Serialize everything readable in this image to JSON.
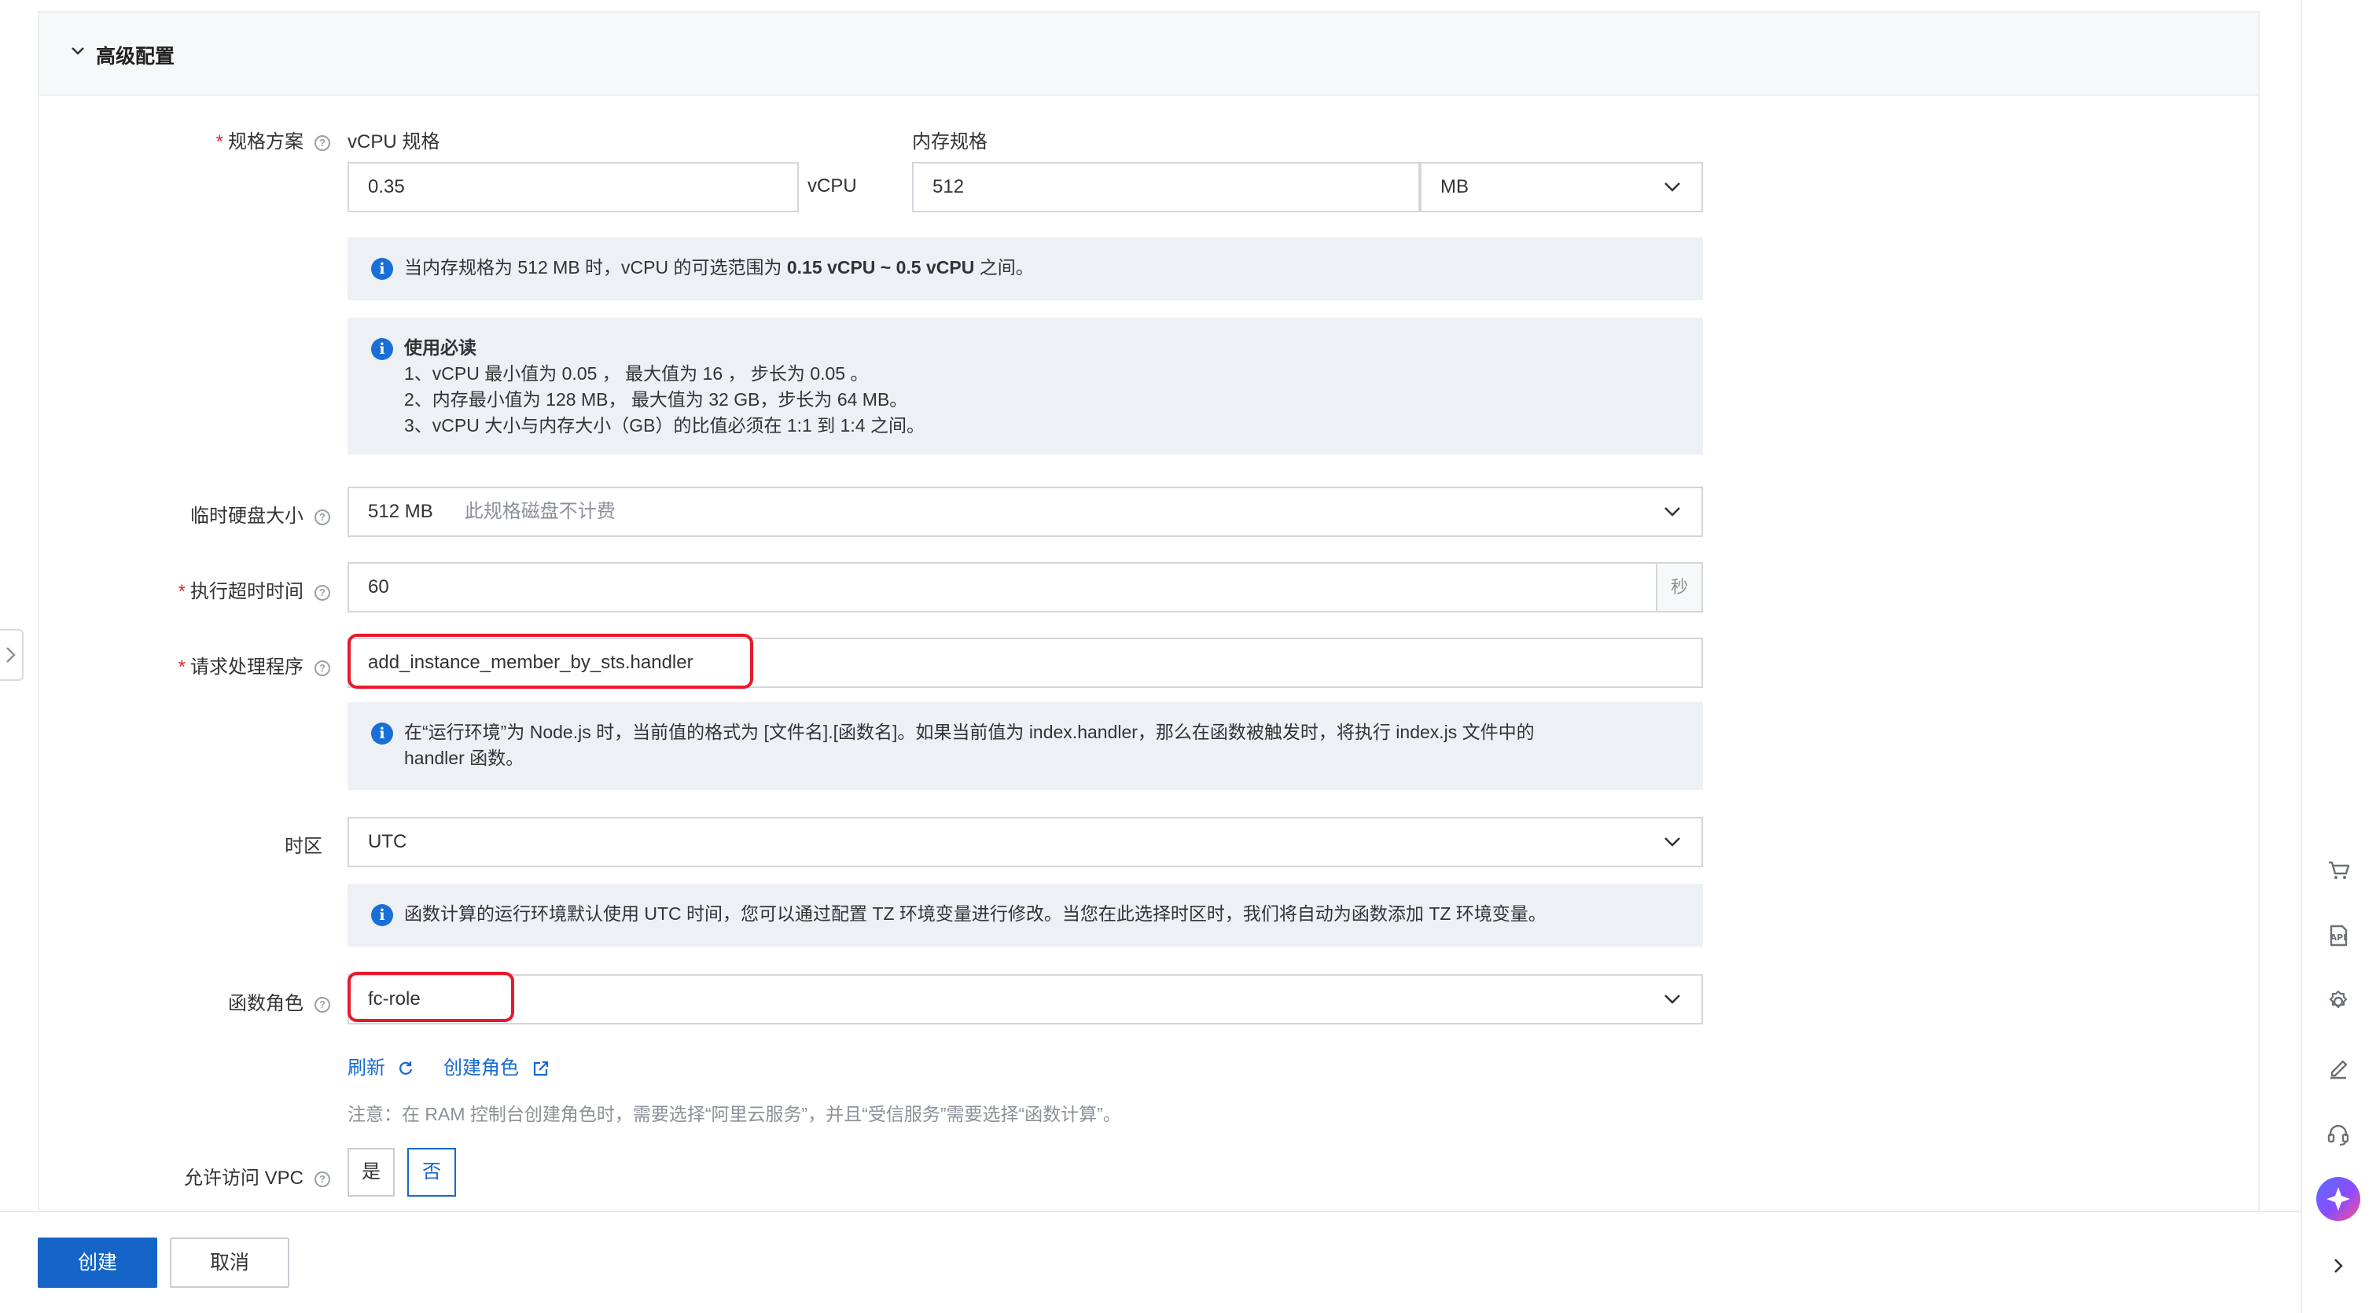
{
  "panel": {
    "title": "高级配置"
  },
  "spec": {
    "label": "规格方案",
    "vcpu_label": "vCPU 规格",
    "vcpu_value": "0.35",
    "vcpu_unit": "vCPU",
    "mem_label": "内存规格",
    "mem_value": "512",
    "mem_unit": "MB",
    "range_tip_prefix": "当内存规格为 512 MB 时，vCPU 的可选范围为 ",
    "range_tip_bold": "0.15 vCPU ~ 0.5 vCPU",
    "range_tip_suffix": " 之间。",
    "notes_title": "使用必读",
    "notes": [
      "1、vCPU 最小值为 0.05 ， 最大值为 16 ， 步长为 0.05 。",
      "2、内存最小值为 128 MB， 最大值为 32 GB，步长为 64 MB。",
      "3、vCPU 大小与内存大小（GB）的比值必须在 1:1 到 1:4 之间。"
    ]
  },
  "disk": {
    "label": "临时硬盘大小",
    "value": "512 MB",
    "hint": "此规格磁盘不计费"
  },
  "timeout": {
    "label": "执行超时时间",
    "value": "60",
    "unit": "秒"
  },
  "handler": {
    "label": "请求处理程序",
    "value": "add_instance_member_by_sts.handler",
    "tip_line1": "在“运行环境”为 Node.js 时，当前值的格式为 [文件名].[函数名]。如果当前值为 index.handler，那么在函数被触发时，将执行 index.js 文件中的",
    "tip_line2": "handler 函数。"
  },
  "timezone": {
    "label": "时区",
    "value": "UTC",
    "tip": "函数计算的运行环境默认使用 UTC 时间，您可以通过配置 TZ 环境变量进行修改。当您在此选择时区时，我们将自动为函数添加 TZ 环境变量。"
  },
  "role": {
    "label": "函数角色",
    "value": "fc-role",
    "refresh": "刷新",
    "create": "创建角色",
    "note": "注意：在 RAM 控制台创建角色时，需要选择“阿里云服务”，并且“受信服务”需要选择“函数计算”。"
  },
  "vpc": {
    "label": "允许访问 VPC",
    "yes": "是",
    "no": "否",
    "selected": "否"
  },
  "footer": {
    "create": "创建",
    "cancel": "取消"
  },
  "rail_icons": [
    "cart-icon",
    "api-icon",
    "gear-icon",
    "edit-icon",
    "headset-icon",
    "ai-assistant-icon",
    "chevron-right-icon"
  ],
  "colors": {
    "primary": "#1565c8",
    "highlight": "#e8192c",
    "info": "#1a6fd6",
    "info_bg": "#edf0f5",
    "required": "#e0252b"
  }
}
